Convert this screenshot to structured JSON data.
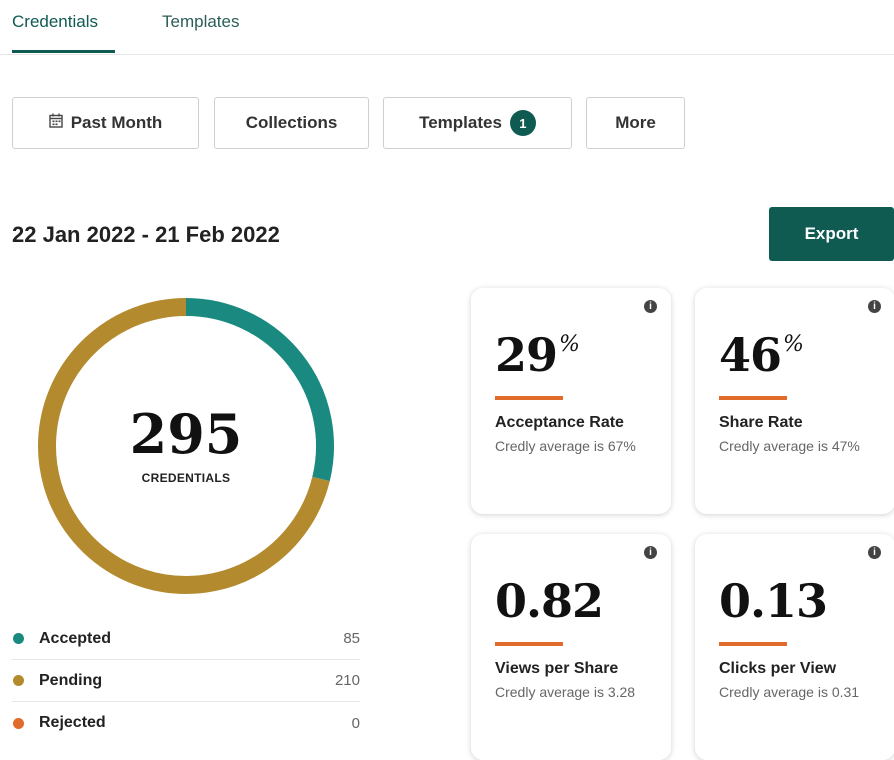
{
  "tabs": [
    {
      "label": "Credentials",
      "active": true
    },
    {
      "label": "Templates",
      "active": false
    }
  ],
  "filters": {
    "past_month": "Past Month",
    "collections": "Collections",
    "templates": "Templates",
    "templates_badge": "1",
    "more": "More"
  },
  "date_range": "22 Jan 2022 - 21 Feb 2022",
  "export_label": "Export",
  "donut": {
    "total": "295",
    "label": "CREDENTIALS"
  },
  "legend": [
    {
      "label": "Accepted",
      "value": "85",
      "color": "#1a8a80"
    },
    {
      "label": "Pending",
      "value": "210",
      "color": "#b38a2e"
    },
    {
      "label": "Rejected",
      "value": "0",
      "color": "#e06b2a"
    }
  ],
  "cards": [
    {
      "value": "29",
      "suffix": "%",
      "metric": "Acceptance Rate",
      "note": "Credly average is 67%"
    },
    {
      "value": "46",
      "suffix": "%",
      "metric": "Share Rate",
      "note": "Credly average is 47%"
    },
    {
      "value": "0.82",
      "suffix": "",
      "metric": "Views per Share",
      "note": "Credly average is 3.28"
    },
    {
      "value": "0.13",
      "suffix": "",
      "metric": "Clicks per View",
      "note": "Credly average is 0.31"
    }
  ],
  "colors": {
    "accent": "#0f5b52",
    "accepted": "#1a8a80",
    "pending": "#b38a2e",
    "rejected": "#e06b2a"
  },
  "icons": {
    "calendar": "calendar-icon",
    "info": "info-icon"
  }
}
